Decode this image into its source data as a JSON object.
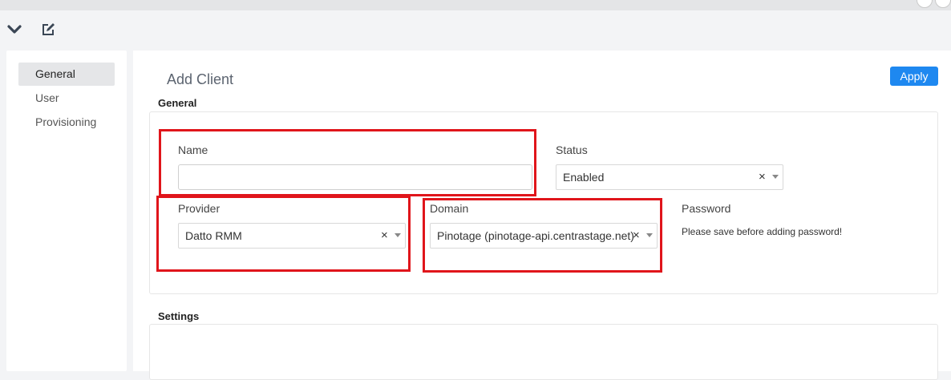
{
  "toolbar": {
    "collapse_icon": "chevron-down-icon",
    "edit_icon": "edit-icon"
  },
  "sidebar": {
    "items": [
      {
        "label": "General",
        "active": true
      },
      {
        "label": "User",
        "active": false
      },
      {
        "label": "Provisioning",
        "active": false
      }
    ]
  },
  "page": {
    "title": "Add Client",
    "apply_label": "Apply"
  },
  "general_section": {
    "title": "General",
    "name": {
      "label": "Name",
      "value": ""
    },
    "status": {
      "label": "Status",
      "value": "Enabled"
    },
    "provider": {
      "label": "Provider",
      "value": "Datto RMM"
    },
    "domain": {
      "label": "Domain",
      "value": "Pinotage (pinotage-api.centrastage.net)"
    },
    "password": {
      "label": "Password",
      "note": "Please save before adding password!"
    },
    "clear_glyph": "×"
  },
  "settings_section": {
    "title": "Settings"
  },
  "colors": {
    "accent": "#1e88f0",
    "highlight": "#e0151b",
    "active_item": "#e5e6e8"
  }
}
